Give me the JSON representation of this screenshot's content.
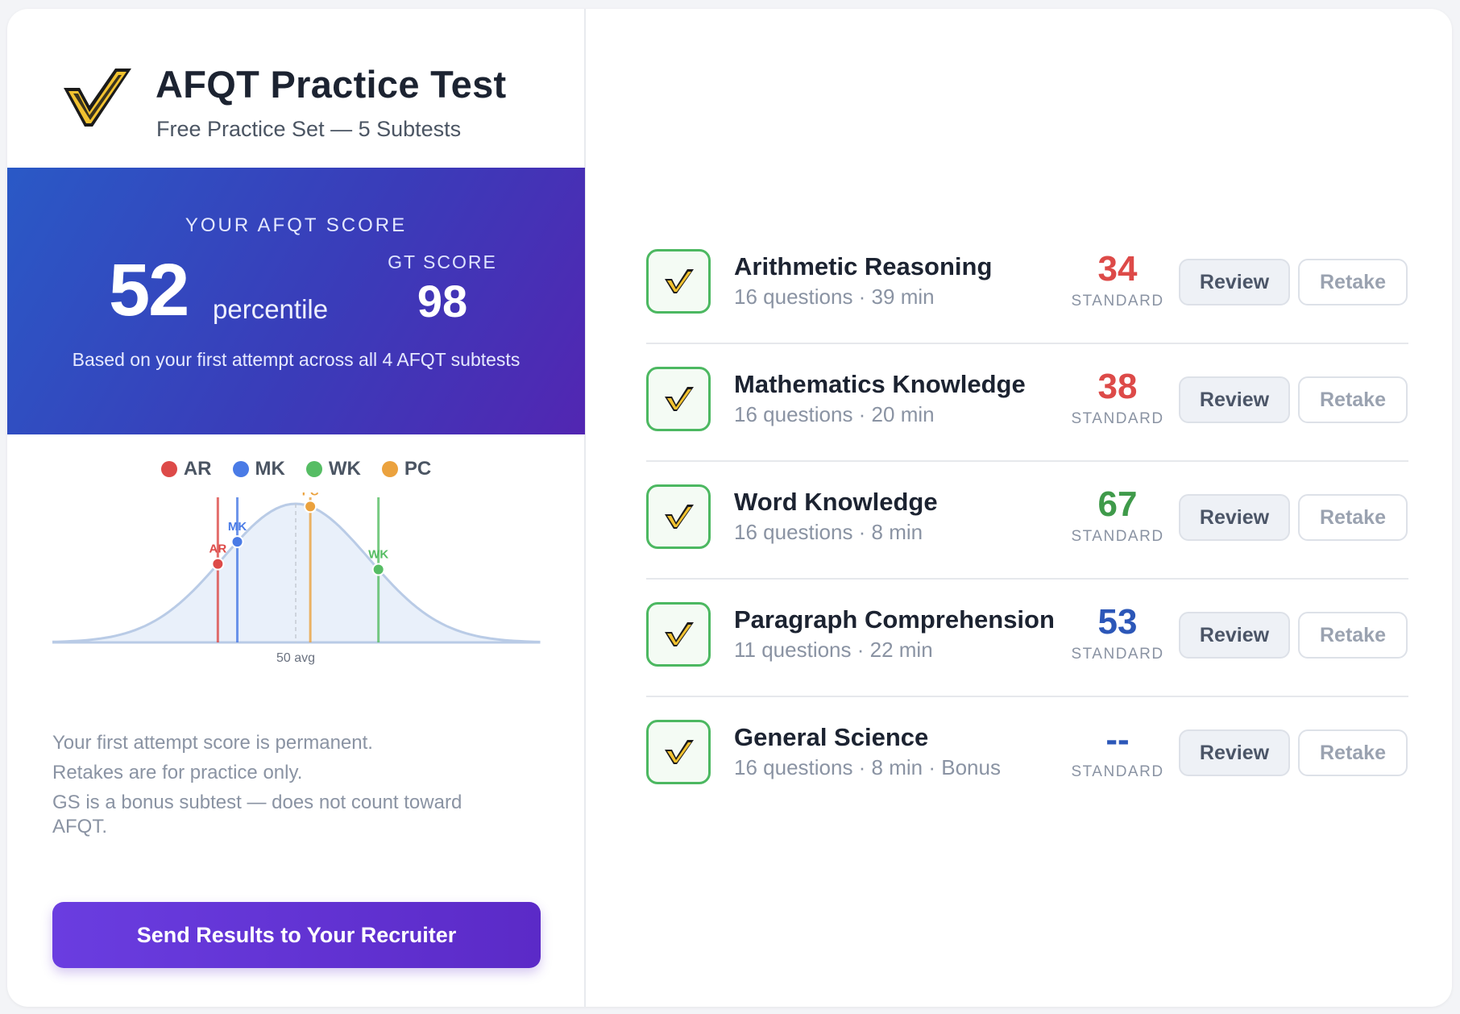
{
  "header": {
    "title": "AFQT Practice Test",
    "subtitle": "Free Practice Set — 5 Subtests"
  },
  "score": {
    "label": "YOUR AFQT SCORE",
    "percentile": "52",
    "percentile_word": "percentile",
    "gt_label": "GT SCORE",
    "gt_value": "98",
    "note": "Based on your first attempt across all 4 AFQT subtests"
  },
  "legend": [
    {
      "label": "AR",
      "color": "#dd4a48"
    },
    {
      "label": "MK",
      "color": "#4a7be6"
    },
    {
      "label": "WK",
      "color": "#56bd64"
    },
    {
      "label": "PC",
      "color": "#eba23e"
    }
  ],
  "chart_data": {
    "type": "area",
    "title": "",
    "xlabel": "",
    "ylabel": "",
    "center_label": "50 avg",
    "center": 50,
    "xlim": [
      0,
      100
    ],
    "markers": [
      {
        "label": "AR",
        "x": 34,
        "color": "#dd4a48"
      },
      {
        "label": "MK",
        "x": 38,
        "color": "#4a7be6"
      },
      {
        "label": "PC",
        "x": 53,
        "color": "#eba23e"
      },
      {
        "label": "WK",
        "x": 67,
        "color": "#56bd64"
      }
    ]
  },
  "notes": [
    "Your first attempt score is permanent.",
    "Retakes are for practice only.",
    "GS is a bonus subtest — does not count toward AFQT."
  ],
  "send_button": "Send Results to Your Recruiter",
  "subtests": [
    {
      "name": "Arithmetic Reasoning",
      "meta": "16 questions · 39 min",
      "score": "34",
      "score_color": "#dd4a48",
      "standard_label": "STANDARD",
      "review": "Review",
      "retake": "Retake"
    },
    {
      "name": "Mathematics Knowledge",
      "meta": "16 questions · 20 min",
      "score": "38",
      "score_color": "#dd4a48",
      "standard_label": "STANDARD",
      "review": "Review",
      "retake": "Retake"
    },
    {
      "name": "Word Knowledge",
      "meta": "16 questions · 8 min",
      "score": "67",
      "score_color": "#3f9a4a",
      "standard_label": "STANDARD",
      "review": "Review",
      "retake": "Retake"
    },
    {
      "name": "Paragraph Comprehension",
      "meta": "11 questions · 22 min",
      "score": "53",
      "score_color": "#2c57b8",
      "standard_label": "STANDARD",
      "review": "Review",
      "retake": "Retake"
    },
    {
      "name": "General Science",
      "meta": "16 questions · 8 min · Bonus",
      "score": "--",
      "score_color": "#2c57b8",
      "standard_label": "STANDARD",
      "review": "Review",
      "retake": "Retake"
    }
  ]
}
